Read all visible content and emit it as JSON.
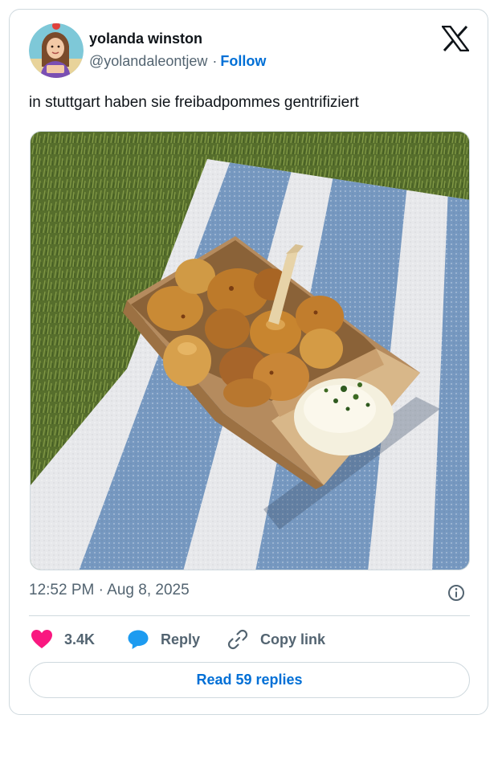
{
  "author": {
    "display_name": "yolanda winston",
    "handle": "@yolandaleontjew",
    "separator": "·",
    "follow_label": "Follow",
    "avatar_icon": "avatar-illustration"
  },
  "platform": {
    "logo_icon": "x-logo-icon"
  },
  "tweet": {
    "text": "in stuttgart haben sie freibadpommes gentrifiziert",
    "media_icon": "photo-fries-on-striped-towel",
    "timestamp": "12:52 PM · Aug 8, 2025"
  },
  "actions": {
    "like_count": "3.4K",
    "reply_label": "Reply",
    "copy_link_label": "Copy link",
    "read_replies_label": "Read 59 replies"
  },
  "colors": {
    "like": "#f91880",
    "reply": "#1d9bf0",
    "link": "#006fd6",
    "muted": "#536471",
    "border": "#cfd9de"
  }
}
